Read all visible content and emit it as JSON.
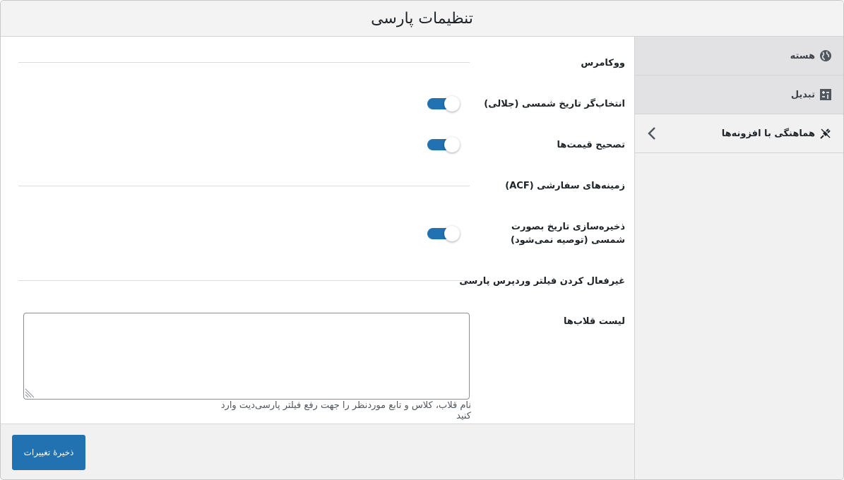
{
  "header": {
    "title": "تنظیمات پارسی"
  },
  "sidebar": {
    "items": [
      {
        "label": "هسته",
        "icon": "globe-icon",
        "state": "inactive"
      },
      {
        "label": "تبدیل",
        "icon": "converter-icon",
        "state": "inactive"
      },
      {
        "label": "هماهنگی با افزونه‌ها",
        "icon": "plugin-plug-icon",
        "state": "active"
      }
    ]
  },
  "main": {
    "sections": {
      "woocommerce": "ووکامرس",
      "acf": "زمینه‌های سفارشی (ACF)",
      "disable_filter": "غیرفعال کردن فیلتر وردپرس پارسی"
    },
    "settings": {
      "jalali_datepicker": {
        "label": "انتخاب‌گر تاریخ شمسی (جلالی)",
        "enabled": true
      },
      "price_fix": {
        "label": "تصحیح قیمت‌ها",
        "enabled": true
      },
      "acf_jalali_save": {
        "label": "ذخیره‌سازی تاریخ بصورت شمسی (توصیه نمی‌شود)",
        "enabled": true
      },
      "hooks_list": {
        "label": "لیست قلاب‌ها",
        "value": "",
        "description": "نام قلاب، کلاس و تابع موردنظر را جهت رفع فیلتر پارسی‌دیت وارد کنید"
      }
    }
  },
  "footer": {
    "save_label": "ذخیرهٔ تغییرات"
  },
  "colors": {
    "accent": "#2271b1",
    "sidebar_inactive": "#e2e2e4",
    "background": "#f1f1f1"
  }
}
